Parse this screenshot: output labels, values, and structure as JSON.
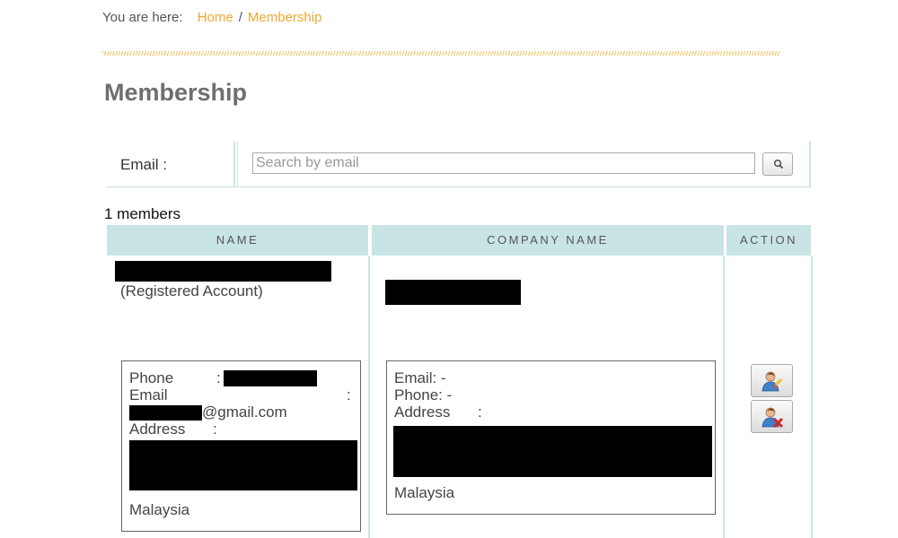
{
  "breadcrumb": {
    "prefix": "You are here:",
    "items": [
      "Home",
      "Membership"
    ],
    "separator": "/"
  },
  "page": {
    "title": "Membership"
  },
  "search": {
    "label": "Email :",
    "placeholder": "Search by email",
    "value": "",
    "button_icon": "search-icon"
  },
  "summary": {
    "count_text": "1 members"
  },
  "table": {
    "headers": [
      "NAME",
      "COMPANY NAME",
      "ACTION"
    ],
    "rows": [
      {
        "name_note": "(Registered Account)",
        "contact": {
          "phone_label": "Phone",
          "phone_sep": ":",
          "email_label": "Email",
          "email_sep": ":",
          "email_domain": "@gmail.com",
          "address_label": "Address",
          "address_sep": ":",
          "country": "Malaysia"
        },
        "company": {
          "email_line": "Email: -",
          "phone_line": "Phone: -",
          "address_label": "Address",
          "address_sep": ":",
          "country": "Malaysia"
        },
        "actions": [
          "edit-user-icon",
          "delete-user-icon"
        ]
      }
    ]
  },
  "colors": {
    "accent": "#f0a830",
    "header_bg": "#c9e4e5",
    "title": "#6f6f6f"
  }
}
